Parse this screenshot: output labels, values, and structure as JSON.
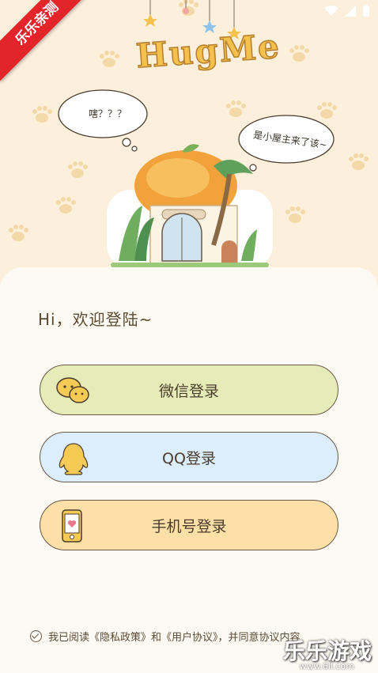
{
  "status_bar": {
    "icons": [
      "wifi-icon",
      "signal-icon",
      "battery-icon"
    ]
  },
  "badge": {
    "label": "乐乐亲测"
  },
  "hero": {
    "logo": "HugMe",
    "bubble_left": "嗐？？？",
    "bubble_right": "是小屋主来了该~"
  },
  "login": {
    "greeting": "Hi，欢迎登陆~",
    "wechat_label": "微信登录",
    "qq_label": "QQ登录",
    "phone_label": "手机号登录"
  },
  "agreement": {
    "text": "我已阅读《隐私政策》和《用户协议》，并同意协议内容"
  },
  "watermark": {
    "brand": "乐乐游戏",
    "url": "www.6ll.com"
  },
  "colors": {
    "wechat": "#e6ecb8",
    "qq": "#dceefb",
    "phone": "#fde0a8",
    "badge": "#e3242b"
  }
}
